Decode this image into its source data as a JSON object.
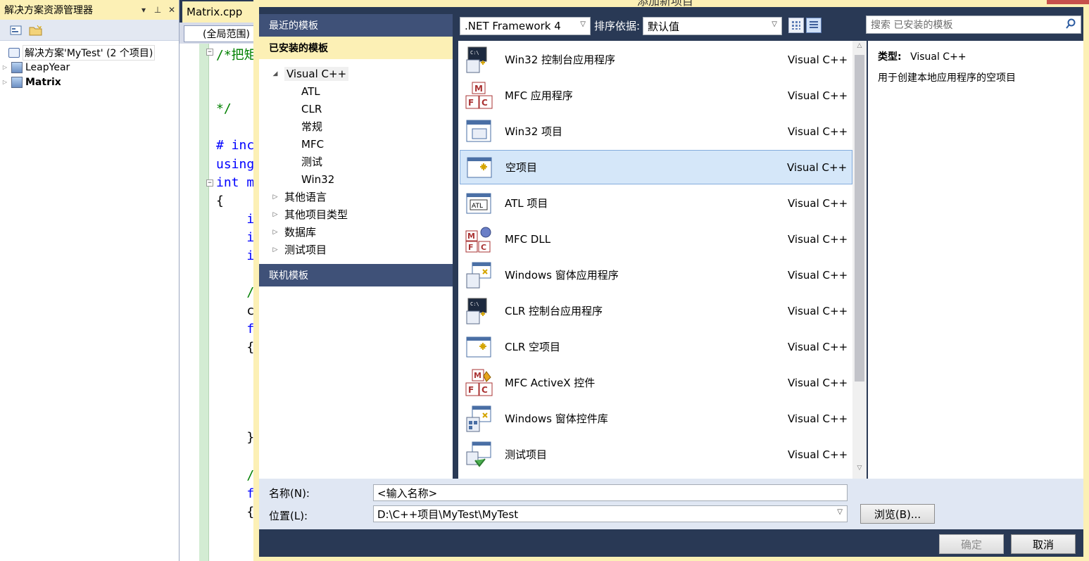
{
  "solution_explorer": {
    "title": "解决方案资源管理器",
    "pin_glyph": "▾ 卩 ✕",
    "solution_label": "解决方案'MyTest' (2 个项目)",
    "projects": [
      {
        "name": "LeapYear",
        "bold": false
      },
      {
        "name": "Matrix",
        "bold": true
      }
    ]
  },
  "editor": {
    "tab_label": "Matrix.cpp",
    "scope_label": "(全局范围)",
    "lines": [
      {
        "text": "/*把矩",
        "cls": "cm"
      },
      {
        "text": "*/",
        "cls": "cm"
      },
      {
        "text": "# inc",
        "cls": "pp"
      },
      {
        "text": "using",
        "cls": "kw"
      },
      {
        "text": "int m",
        "cls": "kw"
      },
      {
        "text": "{",
        "cls": ""
      },
      {
        "text": "    i",
        "cls": "kw"
      },
      {
        "text": "    i",
        "cls": "kw"
      },
      {
        "text": "    i",
        "cls": "kw"
      },
      {
        "text": "    /",
        "cls": "cm"
      },
      {
        "text": "    c",
        "cls": ""
      },
      {
        "text": "    f",
        "cls": "kw"
      },
      {
        "text": "    {",
        "cls": ""
      },
      {
        "text": "    }",
        "cls": ""
      },
      {
        "text": "    /",
        "cls": "cm"
      },
      {
        "text": "    f",
        "cls": "kw"
      },
      {
        "text": "    {",
        "cls": ""
      }
    ]
  },
  "dialog": {
    "title": "添加新项目",
    "sections": {
      "recent": "最近的模板",
      "installed": "已安装的模板",
      "online": "联机模板"
    },
    "tree": {
      "root": "Visual C++",
      "children": [
        "ATL",
        "CLR",
        "常规",
        "MFC",
        "测试",
        "Win32"
      ],
      "others": [
        "其他语言",
        "其他项目类型",
        "数据库",
        "测试项目"
      ]
    },
    "framework": ".NET Framework 4",
    "sort_label": "排序依据:",
    "sort_value": "默认值",
    "search_placeholder": "搜索 已安装的模板",
    "templates": [
      {
        "name": "Win32 控制台应用程序",
        "lang": "Visual C++",
        "icon": "console-app-icon"
      },
      {
        "name": "MFC 应用程序",
        "lang": "Visual C++",
        "icon": "mfc-app-icon"
      },
      {
        "name": "Win32 项目",
        "lang": "Visual C++",
        "icon": "win32-project-icon"
      },
      {
        "name": "空项目",
        "lang": "Visual C++",
        "icon": "empty-project-icon",
        "selected": true
      },
      {
        "name": "ATL 项目",
        "lang": "Visual C++",
        "icon": "atl-project-icon"
      },
      {
        "name": "MFC DLL",
        "lang": "Visual C++",
        "icon": "mfc-dll-icon"
      },
      {
        "name": "Windows 窗体应用程序",
        "lang": "Visual C++",
        "icon": "winforms-app-icon"
      },
      {
        "name": "CLR 控制台应用程序",
        "lang": "Visual C++",
        "icon": "clr-console-icon"
      },
      {
        "name": "CLR 空项目",
        "lang": "Visual C++",
        "icon": "clr-empty-icon"
      },
      {
        "name": "MFC ActiveX 控件",
        "lang": "Visual C++",
        "icon": "mfc-activex-icon"
      },
      {
        "name": "Windows 窗体控件库",
        "lang": "Visual C++",
        "icon": "winforms-library-icon"
      },
      {
        "name": "测试项目",
        "lang": "Visual C++",
        "icon": "test-project-icon"
      }
    ],
    "description": {
      "type_label": "类型:",
      "type_value": "Visual C++",
      "text": "用于创建本地应用程序的空项目"
    },
    "name_label": "名称(N):",
    "name_value": "<输入名称>",
    "location_label": "位置(L):",
    "location_value": "D:\\C++项目\\MyTest\\MyTest",
    "browse_label": "浏览(B)...",
    "ok_label": "确定",
    "cancel_label": "取消"
  }
}
